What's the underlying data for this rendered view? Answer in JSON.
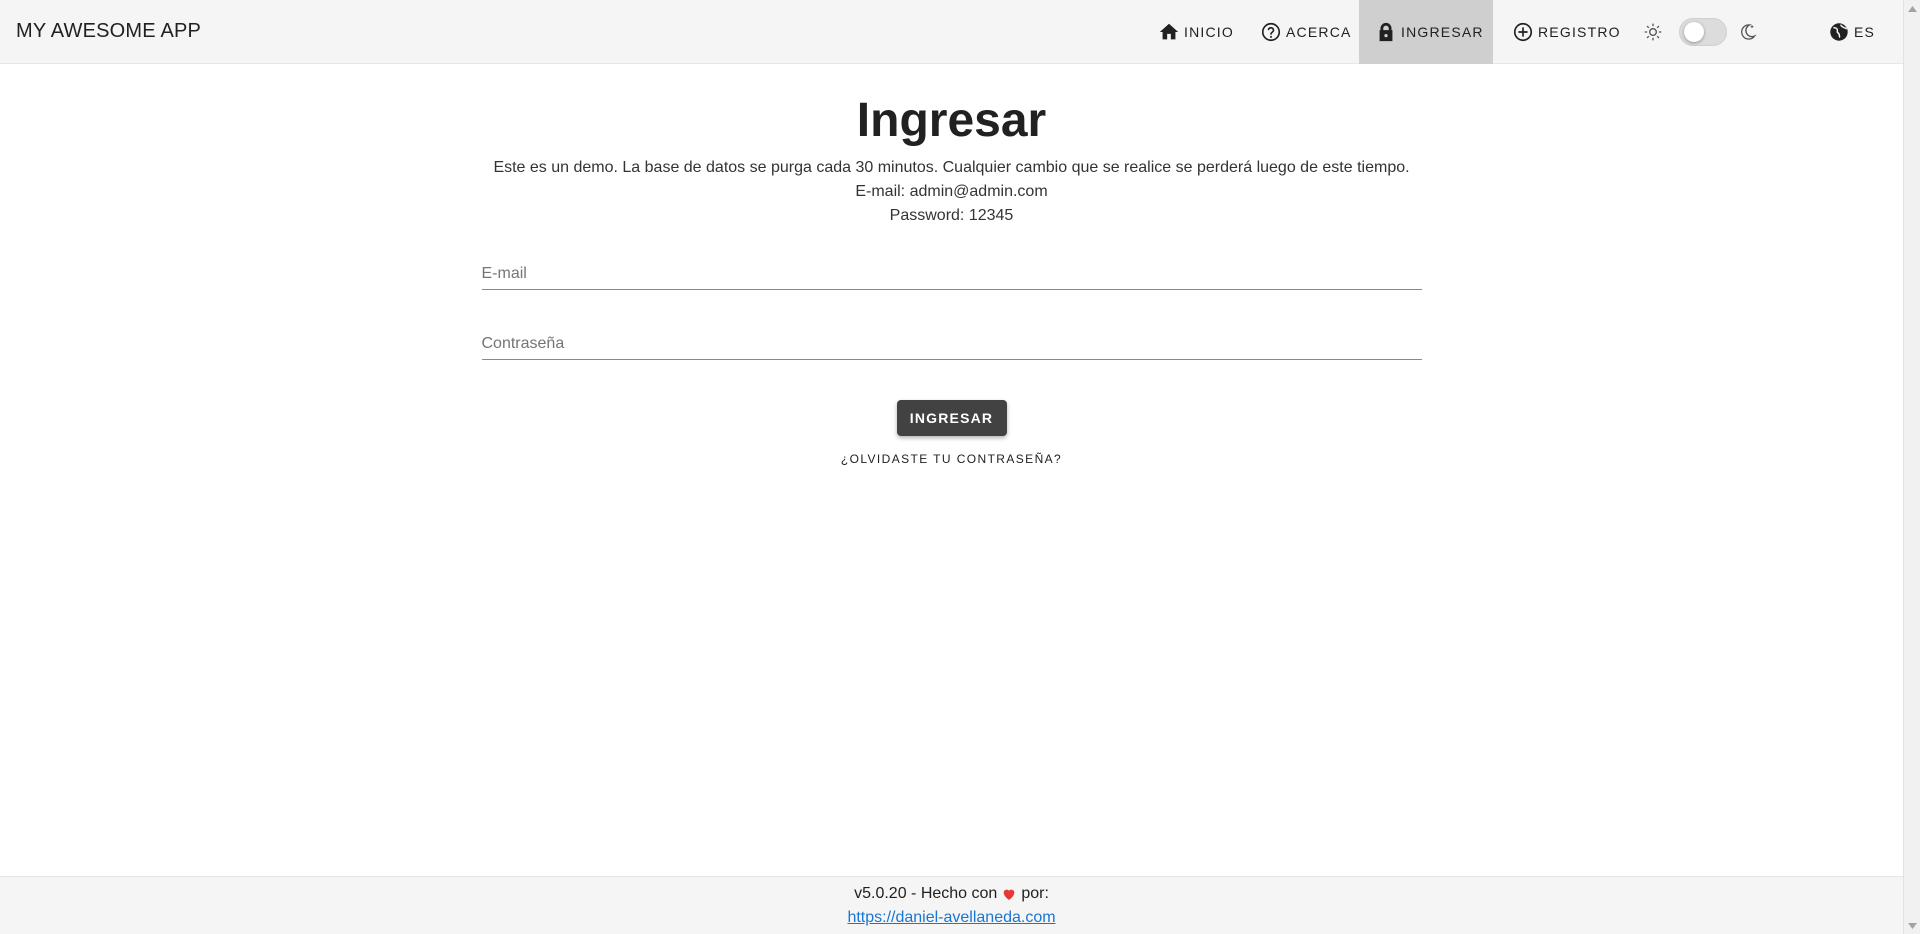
{
  "app": {
    "title": "MY AWESOME APP"
  },
  "nav": {
    "items": [
      {
        "label": "INICIO",
        "icon": "home-icon"
      },
      {
        "label": "ACERCA",
        "icon": "help-circle-icon"
      },
      {
        "label": "INGRESAR",
        "icon": "lock-icon",
        "active": true
      },
      {
        "label": "REGISTRO",
        "icon": "plus-circle-icon"
      }
    ],
    "theme": {
      "light_icon": "sun-icon",
      "dark_icon": "moon-icon",
      "dark_enabled": false
    },
    "language": {
      "label": "ES",
      "icon": "globe-icon"
    }
  },
  "login": {
    "title": "Ingresar",
    "info": [
      "Este es un demo. La base de datos se purga cada 30 minutos. Cualquier cambio que se realice se perderá luego de este tiempo.",
      "E-mail: admin@admin.com",
      "Password: 12345"
    ],
    "email_placeholder": "E-mail",
    "email_value": "",
    "password_placeholder": "Contraseña",
    "password_value": "",
    "submit_label": "INGRESAR",
    "forgot_label": "¿OLVIDASTE TU CONTRASEÑA?"
  },
  "footer": {
    "prefix": "v5.0.20 - Hecho con",
    "heart_icon": "heart-icon",
    "suffix": "por:",
    "link": "https://daniel-avellaneda.com"
  },
  "colors": {
    "topbar_bg": "#f5f5f5",
    "active_nav_bg": "#cfcfcf",
    "button_bg": "#424242",
    "link": "#1976d2",
    "heart": "#e53935"
  }
}
